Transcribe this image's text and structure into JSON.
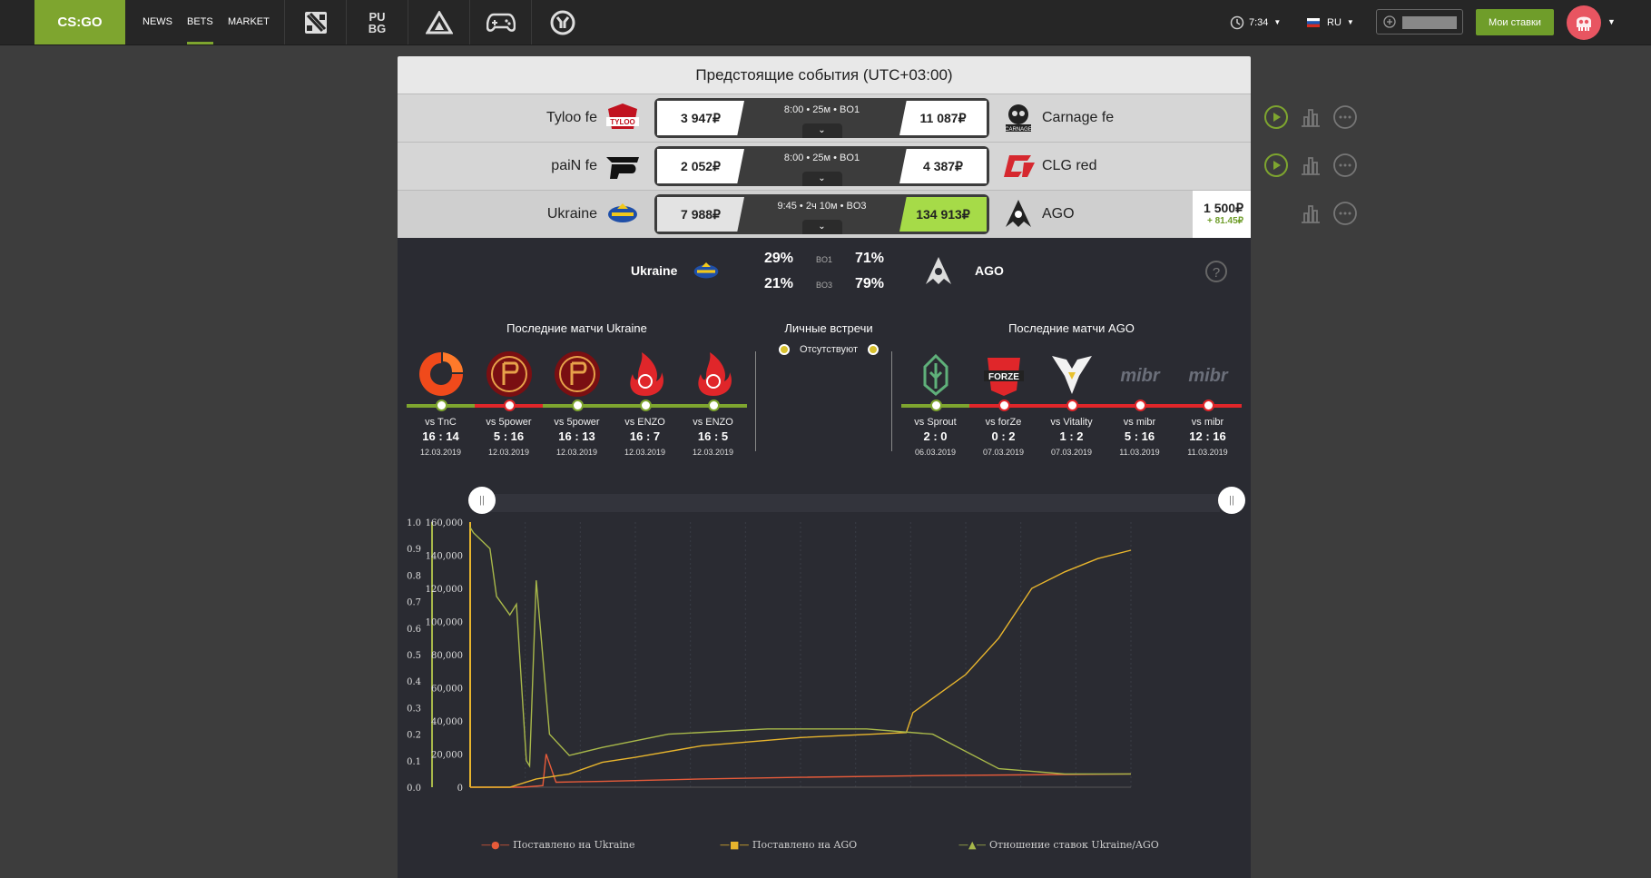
{
  "nav": {
    "logo": "CS:GO",
    "links": [
      "NEWS",
      "BETS",
      "MARKET"
    ],
    "active_link": "BETS",
    "game_tabs": [
      "dota2-icon",
      "pubg-icon",
      "artifact-icon",
      "gamepad-icon",
      "overwatch-icon"
    ],
    "pubg_label": "PU BG",
    "time": "7:34",
    "language": "RU",
    "my_bets": "Мои ставки"
  },
  "events": {
    "title": "Предстоящие события (UTC+03:00)",
    "matches": [
      {
        "left_team": "Tyloo fe",
        "left_odd": "3 947₽",
        "info": "8:00 • 25м • BO1",
        "right_odd": "11 087₽",
        "right_team": "Carnage fe",
        "left_logo_text": "TYLOO",
        "right_logo_text": "CARNAGE"
      },
      {
        "left_team": "paiN fe",
        "left_odd": "2 052₽",
        "info": "8:00 • 25м • BO1",
        "right_odd": "4 387₽",
        "right_team": "CLG red"
      },
      {
        "left_team": "Ukraine",
        "left_odd": "7 988₽",
        "info": "9:45 • 2ч 10м • BO3",
        "right_odd": "134 913₽",
        "right_team": "AGO",
        "stake": "1 500₽",
        "stake_gain": "+ 81.45₽"
      }
    ]
  },
  "details": {
    "team_left": "Ukraine",
    "team_right": "AGO",
    "rows": [
      {
        "left": "29%",
        "format": "BO1",
        "right": "71%"
      },
      {
        "left": "21%",
        "format": "BO3",
        "right": "79%"
      }
    ],
    "help": "?",
    "recent_left_title": "Последние матчи Ukraine",
    "h2h_title": "Личные встречи",
    "h2h_text": "Отсутствуют",
    "recent_right_title": "Последние матчи AGO",
    "recent_left": [
      {
        "vs": "vs TnC",
        "score": "16 : 14",
        "date": "12.03.2019",
        "win": true
      },
      {
        "vs": "vs 5power",
        "score": "5 : 16",
        "date": "12.03.2019",
        "win": false
      },
      {
        "vs": "vs 5power",
        "score": "16 : 13",
        "date": "12.03.2019",
        "win": true
      },
      {
        "vs": "vs ENZO",
        "score": "16 : 7",
        "date": "12.03.2019",
        "win": true
      },
      {
        "vs": "vs ENZO",
        "score": "16 : 5",
        "date": "12.03.2019",
        "win": true
      }
    ],
    "recent_right": [
      {
        "vs": "vs Sprout",
        "score": "2 : 0",
        "date": "06.03.2019",
        "win": true
      },
      {
        "vs": "vs forZe",
        "score": "0 : 2",
        "date": "07.03.2019",
        "win": false,
        "logo_text": "FORZE"
      },
      {
        "vs": "vs Vitality",
        "score": "1 : 2",
        "date": "07.03.2019",
        "win": false
      },
      {
        "vs": "vs mibr",
        "score": "5 : 16",
        "date": "11.03.2019",
        "win": false,
        "logo_text": "mibr"
      },
      {
        "vs": "vs mibr",
        "score": "12 : 16",
        "date": "11.03.2019",
        "win": false,
        "logo_text": "mibr"
      }
    ]
  },
  "slider": {
    "left_handle": "||",
    "right_handle": "||"
  },
  "colors": {
    "accent": "#7ea52f",
    "win": "#7ea52f",
    "loss": "#e0262a",
    "odds_win": "#a6db48",
    "ukraine_line": "#e65b3a",
    "ago_line": "#e8b52d",
    "ratio_line": "#a8b84a"
  },
  "chart_data": {
    "type": "line",
    "left_axis_ticks": [
      "1.0",
      "0.9",
      "0.8",
      "0.7",
      "0.6",
      "0.5",
      "0.4",
      "0.3",
      "0.2",
      "0.1",
      "0.0"
    ],
    "right_axis_ticks": [
      "160,000",
      "140,000",
      "120,000",
      "100,000",
      "80,000",
      "60,000",
      "40,000",
      "20,000",
      "0"
    ],
    "ylim_ratio": [
      0,
      1
    ],
    "ylim_money": [
      0,
      160000
    ],
    "legend_position": "bottom",
    "series": [
      {
        "name": "Поставлено на Ukraine",
        "axis": "money",
        "x": [
          0,
          0.08,
          0.11,
          0.115,
          0.13,
          0.2,
          0.35,
          0.5,
          0.7,
          1.0
        ],
        "values": [
          0,
          0,
          1000,
          20000,
          3000,
          3500,
          5000,
          6000,
          7000,
          8000
        ]
      },
      {
        "name": "Поставлено на AGO",
        "axis": "money",
        "x": [
          0,
          0.06,
          0.1,
          0.15,
          0.2,
          0.25,
          0.35,
          0.5,
          0.66,
          0.67,
          0.75,
          0.8,
          0.85,
          0.9,
          0.95,
          1.0
        ],
        "values": [
          0,
          0,
          5000,
          8000,
          15000,
          18000,
          25000,
          30000,
          33000,
          45000,
          68000,
          90000,
          120000,
          130000,
          138000,
          143000
        ]
      },
      {
        "name": "Отношение ставок Ukraine/AGO",
        "axis": "ratio",
        "x": [
          0,
          0.005,
          0.03,
          0.04,
          0.06,
          0.07,
          0.085,
          0.09,
          0.1,
          0.12,
          0.15,
          0.2,
          0.3,
          0.45,
          0.6,
          0.7,
          0.8,
          0.9,
          1.0
        ],
        "values": [
          0.98,
          0.96,
          0.9,
          0.72,
          0.65,
          0.69,
          0.1,
          0.08,
          0.78,
          0.2,
          0.12,
          0.15,
          0.2,
          0.22,
          0.22,
          0.2,
          0.07,
          0.05,
          0.05
        ]
      }
    ]
  }
}
